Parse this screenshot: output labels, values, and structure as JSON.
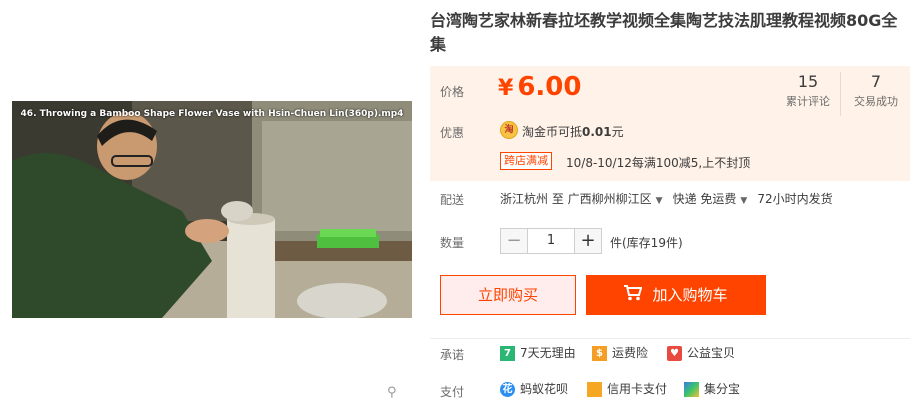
{
  "product": {
    "title": "台湾陶艺家林新春拉坯教学视频全集陶艺技法肌理教程视频80G全集",
    "image_caption": "46. Throwing a Bamboo Shape Flower Vase with Hsin-Chuen Lin(360p).mp4"
  },
  "price": {
    "label": "价格",
    "currency": "¥",
    "value": "6.00",
    "reviews_count": "15",
    "reviews_label": "累计评论",
    "sales_count": "7",
    "sales_label": "交易成功"
  },
  "promo": {
    "label": "优惠",
    "coin_icon": "淘",
    "coin_text": "淘金币可抵",
    "coin_amount": "0.01",
    "coin_unit": "元",
    "cross_store_badge": "跨店满减",
    "cross_store_detail": "10/8-10/12每满100减5,上不封顶"
  },
  "shipping": {
    "label": "配送",
    "from": "浙江杭州 至",
    "to": "广西柳州柳江区",
    "method": "快递 免运费",
    "dispatch": "72小时内发货"
  },
  "quantity": {
    "label": "数量",
    "value": "1",
    "minus": "−",
    "plus": "+",
    "stock": "件(库存19件)"
  },
  "actions": {
    "buy_now": "立即购买",
    "add_to_cart": "加入购物车"
  },
  "promise": {
    "label": "承诺",
    "items": [
      {
        "icon": "7",
        "text": "7天无理由"
      },
      {
        "icon": "$",
        "text": "运费险"
      },
      {
        "icon": "♥",
        "text": "公益宝贝"
      }
    ]
  },
  "payment": {
    "label": "支付",
    "items": [
      {
        "icon": "花",
        "text": "蚂蚁花呗"
      },
      {
        "icon": "",
        "text": "信用卡支付"
      },
      {
        "icon": "",
        "text": "集分宝"
      }
    ]
  },
  "colors": {
    "accent": "#ff4400",
    "price_panel_bg": "#fff2e8",
    "buy_now_bg": "#ffeded"
  }
}
